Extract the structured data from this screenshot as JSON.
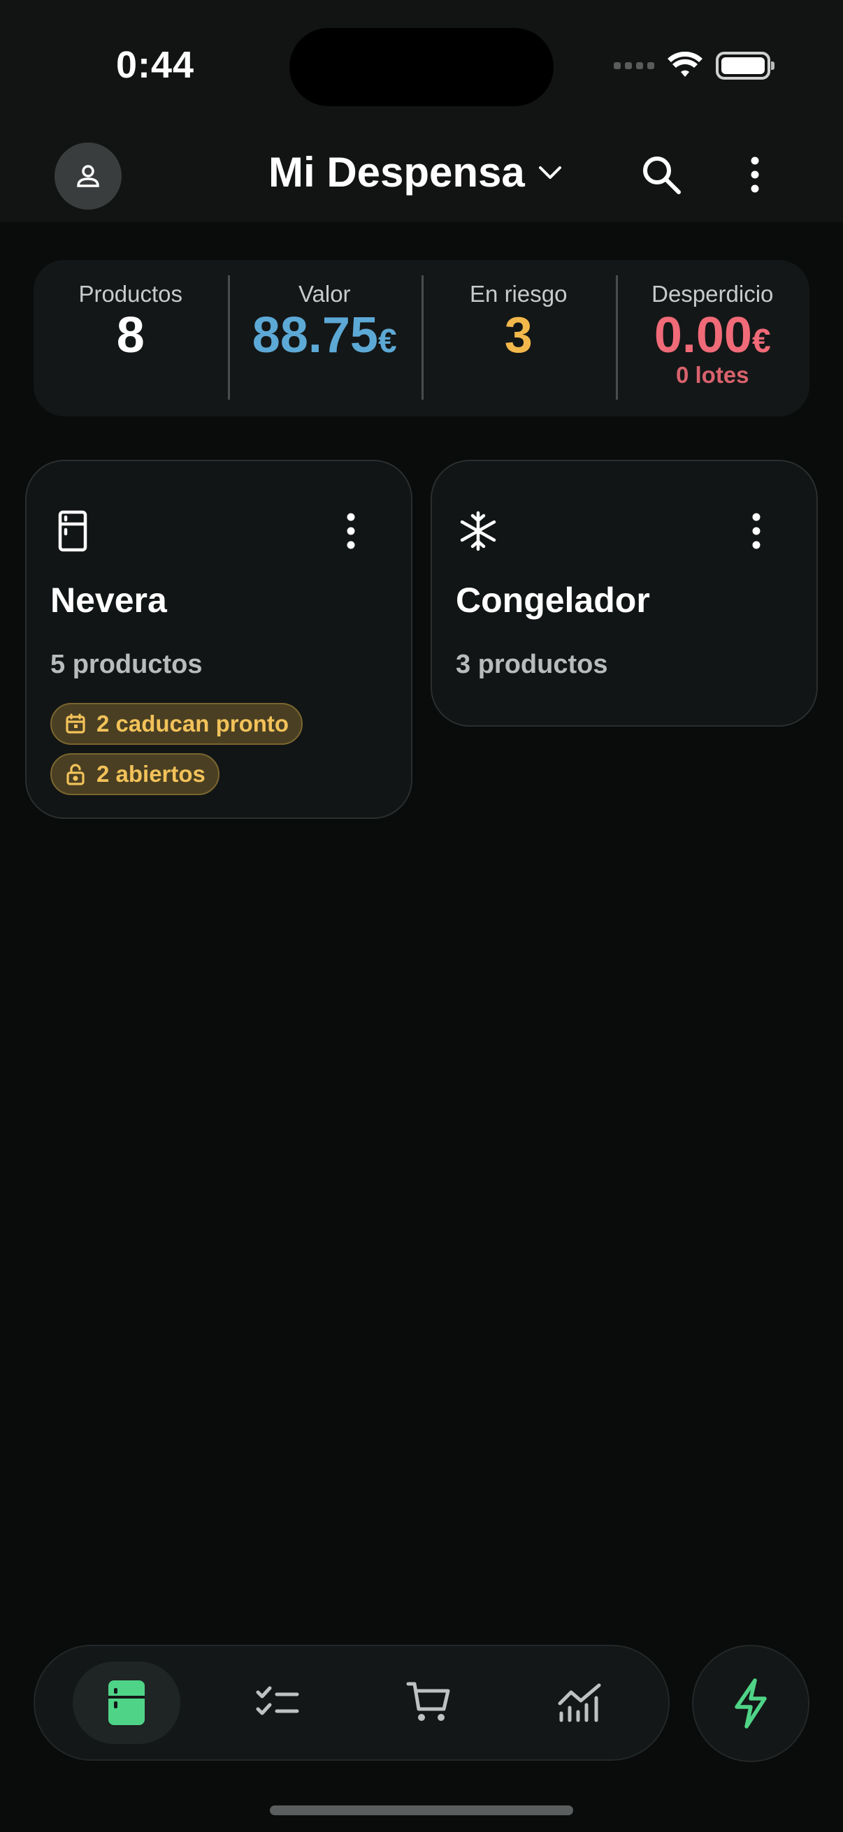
{
  "status": {
    "time": "0:44"
  },
  "header": {
    "title": "Mi Despensa"
  },
  "stats": [
    {
      "label": "Productos",
      "value": "8",
      "currency": "",
      "sub": "",
      "color": "#ffffff"
    },
    {
      "label": "Valor",
      "value": "88.75",
      "currency": "€",
      "sub": "",
      "color": "#5da9d6"
    },
    {
      "label": "En riesgo",
      "value": "3",
      "currency": "",
      "sub": "",
      "color": "#f2b84b"
    },
    {
      "label": "Desperdicio",
      "value": "0.00",
      "currency": "€",
      "sub": "0 lotes",
      "color": "#f06a78"
    }
  ],
  "locations": [
    {
      "title": "Nevera",
      "count": "5 productos",
      "icon": "fridge-icon",
      "badges": [
        {
          "label": "2 caducan pronto",
          "icon": "calendar-icon"
        },
        {
          "label": "2 abiertos",
          "icon": "lock-open-icon"
        }
      ]
    },
    {
      "title": "Congelador",
      "count": "3 productos",
      "icon": "snowflake-icon",
      "badges": []
    }
  ],
  "nav": {
    "items": [
      "pantry-icon",
      "checklist-icon",
      "cart-icon",
      "analytics-icon"
    ],
    "active_index": 0,
    "accent": "#4fd487",
    "fab_icon": "lightning-icon"
  }
}
